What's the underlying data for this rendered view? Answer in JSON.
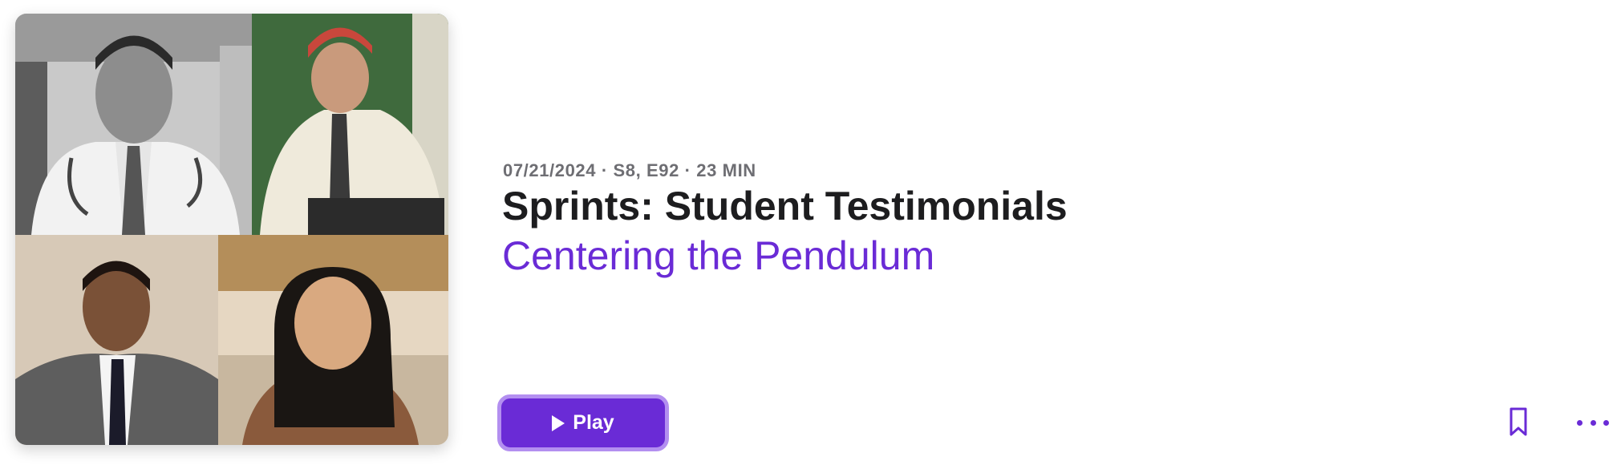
{
  "episode": {
    "meta": "07/21/2024 · S8, E92 · 23 MIN",
    "title": "Sprints: Student Testimonials",
    "show": "Centering the Pendulum"
  },
  "actions": {
    "play_label": "Play",
    "play_icon": "play-icon",
    "bookmark_icon": "bookmark-icon",
    "more_icon": "more-icon"
  },
  "colors": {
    "accent": "#6a2bd6",
    "accent_ring": "#b38ff0",
    "meta_text": "#6e6e73",
    "title_text": "#1d1d1f"
  }
}
